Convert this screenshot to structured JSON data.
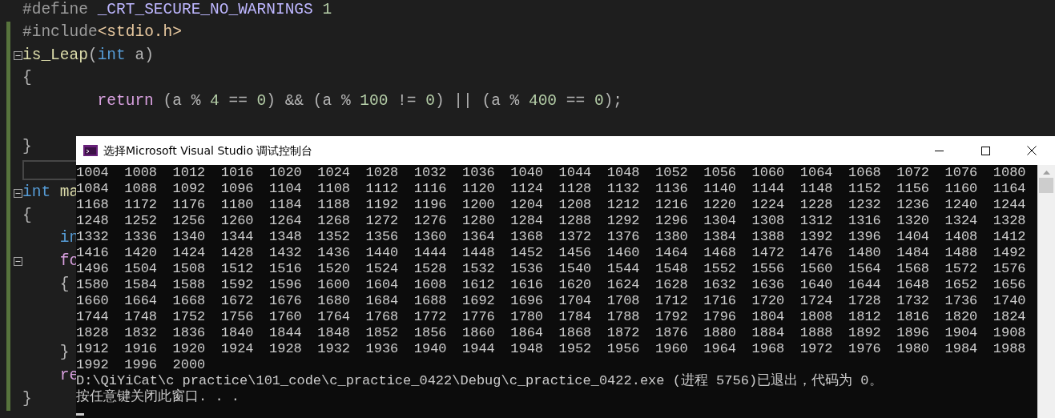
{
  "editor": {
    "lines": [
      {
        "kind": "code",
        "changed": false,
        "tokens": [
          {
            "text": "#define ",
            "kind": "directive"
          },
          {
            "text": "_CRT_SECURE_NO_WARNINGS",
            "kind": "macro"
          },
          {
            "text": " 1",
            "kind": "number"
          }
        ]
      },
      {
        "kind": "code",
        "changed": true,
        "tokens": [
          {
            "text": "#include",
            "kind": "directive"
          },
          {
            "text": "<stdio.h>",
            "kind": "string"
          }
        ]
      },
      {
        "kind": "code",
        "changed": true,
        "expanded": true,
        "tokens": [
          {
            "text": "is_Leap",
            "kind": "function"
          },
          {
            "text": "(",
            "kind": "punct"
          },
          {
            "text": "int",
            "kind": "keyword"
          },
          {
            "text": " a)",
            "kind": "punct"
          }
        ]
      },
      {
        "kind": "code",
        "changed": true,
        "tokens": [
          {
            "text": "{",
            "kind": "punct"
          }
        ]
      },
      {
        "kind": "code",
        "changed": true,
        "tokens": [
          {
            "text": "        return",
            "kind": "control"
          },
          {
            "text": " (a % ",
            "kind": "punct"
          },
          {
            "text": "4",
            "kind": "number"
          },
          {
            "text": " == ",
            "kind": "punct"
          },
          {
            "text": "0",
            "kind": "number"
          },
          {
            "text": ") && (a % ",
            "kind": "punct"
          },
          {
            "text": "100",
            "kind": "number"
          },
          {
            "text": " != ",
            "kind": "punct"
          },
          {
            "text": "0",
            "kind": "number"
          },
          {
            "text": ") || (a % ",
            "kind": "punct"
          },
          {
            "text": "400",
            "kind": "number"
          },
          {
            "text": " == ",
            "kind": "punct"
          },
          {
            "text": "0",
            "kind": "number"
          },
          {
            "text": ");",
            "kind": "punct"
          }
        ]
      },
      {
        "kind": "blank",
        "changed": true
      },
      {
        "kind": "code",
        "changed": true,
        "tokens": [
          {
            "text": "}",
            "kind": "punct"
          }
        ]
      },
      {
        "kind": "current",
        "changed": true
      },
      {
        "kind": "code",
        "changed": true,
        "expanded": true,
        "tokens": [
          {
            "text": "int",
            "kind": "keyword"
          },
          {
            "text": " ma",
            "kind": "function"
          }
        ]
      },
      {
        "kind": "code",
        "changed": true,
        "tokens": [
          {
            "text": "{",
            "kind": "punct"
          }
        ]
      },
      {
        "kind": "code",
        "changed": true,
        "tokens": [
          {
            "text": "    in",
            "kind": "keyword"
          }
        ]
      },
      {
        "kind": "code",
        "changed": true,
        "expanded": true,
        "tokens": [
          {
            "text": "    fo",
            "kind": "control"
          }
        ]
      },
      {
        "kind": "code",
        "changed": true,
        "tokens": [
          {
            "text": "    {",
            "kind": "punct"
          }
        ]
      },
      {
        "kind": "blank",
        "changed": true
      },
      {
        "kind": "blank",
        "changed": true
      },
      {
        "kind": "code",
        "changed": true,
        "tokens": [
          {
            "text": "    }",
            "kind": "punct"
          }
        ]
      },
      {
        "kind": "code",
        "changed": true,
        "tokens": [
          {
            "text": "    re",
            "kind": "control"
          }
        ]
      },
      {
        "kind": "code",
        "changed": true,
        "tokens": [
          {
            "text": "}",
            "kind": "punct"
          }
        ]
      }
    ]
  },
  "console": {
    "title": "选择Microsoft Visual Studio 调试控制台",
    "rows": [
      [
        "1004",
        "1008",
        "1012",
        "1016",
        "1020",
        "1024",
        "1028",
        "1032",
        "1036",
        "1040",
        "1044",
        "1048",
        "1052",
        "1056",
        "1060",
        "1064",
        "1068",
        "1072",
        "1076",
        "1080"
      ],
      [
        "1084",
        "1088",
        "1092",
        "1096",
        "1104",
        "1108",
        "1112",
        "1116",
        "1120",
        "1124",
        "1128",
        "1132",
        "1136",
        "1140",
        "1144",
        "1148",
        "1152",
        "1156",
        "1160",
        "1164"
      ],
      [
        "1168",
        "1172",
        "1176",
        "1180",
        "1184",
        "1188",
        "1192",
        "1196",
        "1200",
        "1204",
        "1208",
        "1212",
        "1216",
        "1220",
        "1224",
        "1228",
        "1232",
        "1236",
        "1240",
        "1244"
      ],
      [
        "1248",
        "1252",
        "1256",
        "1260",
        "1264",
        "1268",
        "1272",
        "1276",
        "1280",
        "1284",
        "1288",
        "1292",
        "1296",
        "1304",
        "1308",
        "1312",
        "1316",
        "1320",
        "1324",
        "1328"
      ],
      [
        "1332",
        "1336",
        "1340",
        "1344",
        "1348",
        "1352",
        "1356",
        "1360",
        "1364",
        "1368",
        "1372",
        "1376",
        "1380",
        "1384",
        "1388",
        "1392",
        "1396",
        "1404",
        "1408",
        "1412"
      ],
      [
        "1416",
        "1420",
        "1424",
        "1428",
        "1432",
        "1436",
        "1440",
        "1444",
        "1448",
        "1452",
        "1456",
        "1460",
        "1464",
        "1468",
        "1472",
        "1476",
        "1480",
        "1484",
        "1488",
        "1492"
      ],
      [
        "1496",
        "1504",
        "1508",
        "1512",
        "1516",
        "1520",
        "1524",
        "1528",
        "1532",
        "1536",
        "1540",
        "1544",
        "1548",
        "1552",
        "1556",
        "1560",
        "1564",
        "1568",
        "1572",
        "1576"
      ],
      [
        "1580",
        "1584",
        "1588",
        "1592",
        "1596",
        "1600",
        "1604",
        "1608",
        "1612",
        "1616",
        "1620",
        "1624",
        "1628",
        "1632",
        "1636",
        "1640",
        "1644",
        "1648",
        "1652",
        "1656"
      ],
      [
        "1660",
        "1664",
        "1668",
        "1672",
        "1676",
        "1680",
        "1684",
        "1688",
        "1692",
        "1696",
        "1704",
        "1708",
        "1712",
        "1716",
        "1720",
        "1724",
        "1728",
        "1732",
        "1736",
        "1740"
      ],
      [
        "1744",
        "1748",
        "1752",
        "1756",
        "1760",
        "1764",
        "1768",
        "1772",
        "1776",
        "1780",
        "1784",
        "1788",
        "1792",
        "1796",
        "1804",
        "1808",
        "1812",
        "1816",
        "1820",
        "1824"
      ],
      [
        "1828",
        "1832",
        "1836",
        "1840",
        "1844",
        "1848",
        "1852",
        "1856",
        "1860",
        "1864",
        "1868",
        "1872",
        "1876",
        "1880",
        "1884",
        "1888",
        "1892",
        "1896",
        "1904",
        "1908"
      ],
      [
        "1912",
        "1916",
        "1920",
        "1924",
        "1928",
        "1932",
        "1936",
        "1940",
        "1944",
        "1948",
        "1952",
        "1956",
        "1960",
        "1964",
        "1968",
        "1972",
        "1976",
        "1980",
        "1984",
        "1988"
      ],
      [
        "1992",
        "1996",
        "2000"
      ]
    ],
    "messages": [
      "D:\\QiYiCat\\c practice\\101_code\\c_practice_0422\\Debug\\c_practice_0422.exe (进程 5756)已退出，代码为 0。",
      "按任意键关闭此窗口. . ."
    ]
  }
}
